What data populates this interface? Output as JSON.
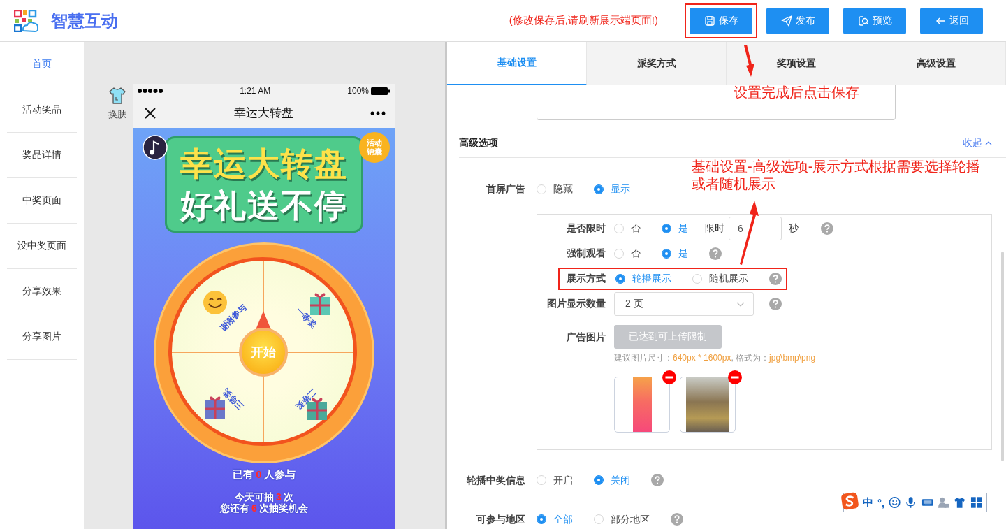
{
  "header": {
    "app_name": "智慧互动",
    "notice": "(修改保存后,请刷新展示端页面!)",
    "buttons": [
      {
        "kind": "save",
        "label": "保存",
        "annotated": true
      },
      {
        "kind": "publish",
        "label": "发布",
        "annotated": false
      },
      {
        "kind": "preview",
        "label": "预览",
        "annotated": false
      },
      {
        "kind": "back",
        "label": "返回",
        "annotated": false
      }
    ]
  },
  "sidebar": {
    "items": [
      {
        "label": "首页",
        "selected": true
      },
      {
        "label": "活动奖品",
        "selected": false
      },
      {
        "label": "奖品详情",
        "selected": false
      },
      {
        "label": "中奖页面",
        "selected": false
      },
      {
        "label": "没中奖页面",
        "selected": false
      },
      {
        "label": "分享效果",
        "selected": false
      },
      {
        "label": "分享图片",
        "selected": false
      }
    ]
  },
  "preview": {
    "skin_label": "换肤",
    "status_time": "1:21 AM",
    "battery": "100%",
    "title": "幸运大转盘",
    "game": {
      "title_lines": [
        "幸运大转盘",
        "好礼送不停"
      ],
      "badge": "活动锦囊",
      "segments": [
        {
          "label": "谢谢参与",
          "kind": "smile"
        },
        {
          "label": "一等奖",
          "kind": "gift"
        },
        {
          "label": "二等奖",
          "kind": "gift"
        },
        {
          "label": "三等奖",
          "kind": "gift"
        }
      ],
      "start": "开始",
      "stats": [
        "已有**0**人参与",
        "今天可抽**3**次",
        "您还有**6**次抽奖机会"
      ]
    }
  },
  "tabs": [
    {
      "label": "基础设置",
      "selected": true
    },
    {
      "label": "派奖方式",
      "selected": false
    },
    {
      "label": "奖项设置",
      "selected": false
    },
    {
      "label": "高级设置",
      "selected": false
    }
  ],
  "section": {
    "title": "高级选项",
    "toggle": "收起"
  },
  "rows": [
    {
      "kind": "radio",
      "label": "首屏广告",
      "options": [
        {
          "label": "隐藏",
          "selected": false
        },
        {
          "label": "显示",
          "selected": true
        }
      ],
      "help": false
    }
  ],
  "ad_panel": [
    {
      "kind": "radio",
      "label": "是否限时",
      "options": [
        {
          "label": "否",
          "selected": false
        },
        {
          "label": "是",
          "selected": true
        }
      ],
      "extra_label": "限时",
      "value": "6",
      "unit": "秒",
      "help": true,
      "annotated": false
    },
    {
      "kind": "radio",
      "label": "强制观看",
      "options": [
        {
          "label": "否",
          "selected": false
        },
        {
          "label": "是",
          "selected": true
        }
      ],
      "help": true,
      "annotated": false
    },
    {
      "kind": "radio",
      "label": "展示方式",
      "options": [
        {
          "label": "轮播展示",
          "selected": true
        },
        {
          "label": "随机展示",
          "selected": false
        }
      ],
      "help": true,
      "annotated": true
    },
    {
      "kind": "select",
      "label": "图片显示数量",
      "value": "2 页",
      "help": true,
      "annotated": false
    },
    {
      "kind": "upload",
      "label": "广告图片",
      "button": "已达到可上传限制",
      "hint": "建议图片尺寸：**640px * 1600px**, 格式为：**jpg\\bmp\\png**",
      "images": [
        {
          "kind": "poster"
        },
        {
          "kind": "photo"
        }
      ],
      "annotated": false
    }
  ],
  "rows_after": [
    {
      "kind": "radio",
      "label": "轮播中奖信息",
      "options": [
        {
          "label": "开启",
          "selected": false
        },
        {
          "label": "关闭",
          "selected": true
        }
      ],
      "help": true
    },
    {
      "kind": "radio",
      "label": "可参与地区",
      "options": [
        {
          "label": "全部",
          "selected": true
        },
        {
          "label": "部分地区",
          "selected": false
        }
      ],
      "help": true
    }
  ],
  "annotations": {
    "save_note": "设置完成后点击保存",
    "display_note": "基础设置-高级选项-展示方式根据需要选择轮播或者随机展示"
  },
  "ime_toolbar": {
    "mode": "中",
    "punct": "°,"
  }
}
